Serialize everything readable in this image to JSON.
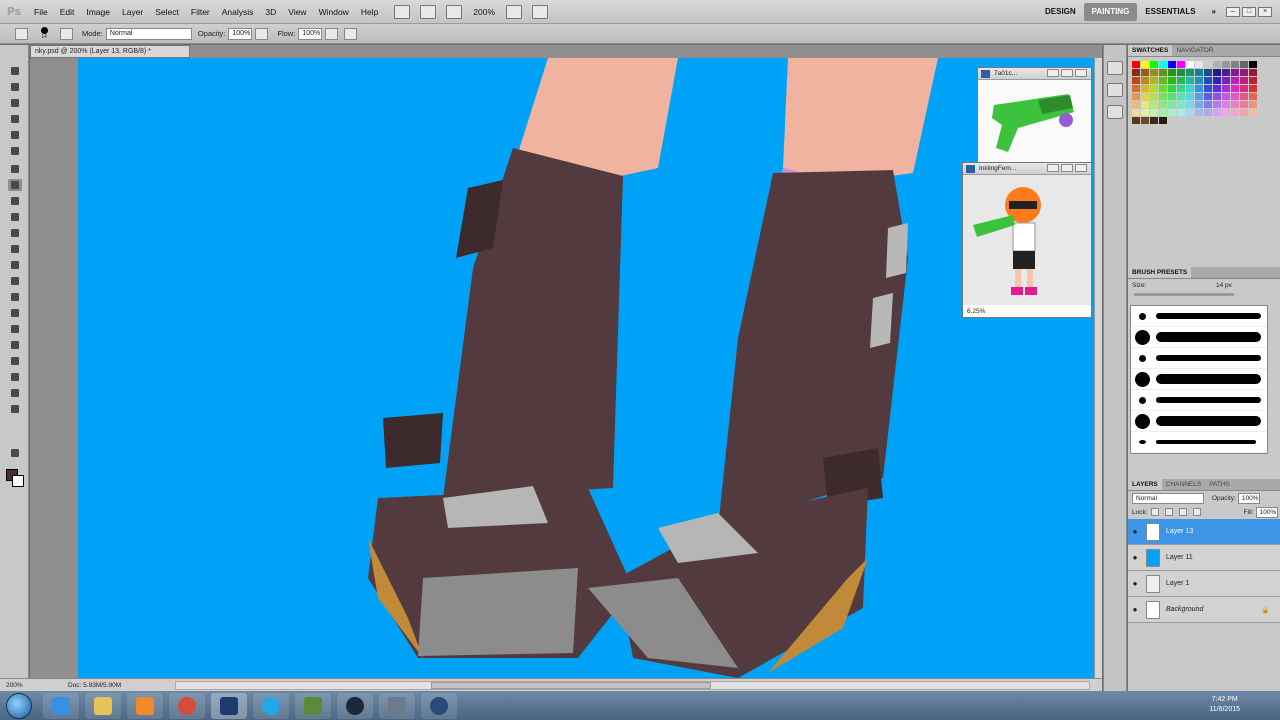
{
  "app": {
    "logo": "Ps"
  },
  "menu": [
    "File",
    "Edit",
    "Image",
    "Layer",
    "Select",
    "Filter",
    "Analysis",
    "3D",
    "View",
    "Window",
    "Help"
  ],
  "menubar": {
    "zoom": "200%"
  },
  "workspaces": {
    "design": "DESIGN",
    "painting": "PAINTING",
    "essentials": "ESSENTIALS",
    "more": "»"
  },
  "options": {
    "brush_size": "14",
    "mode_label": "Mode:",
    "mode_value": "Normal",
    "opacity_label": "Opacity:",
    "opacity_value": "100%",
    "flow_label": "Flow:",
    "flow_value": "100%"
  },
  "document": {
    "tab_title": "nky.psd @ 200% (Layer 13, RGB/8) *"
  },
  "ref_windows": [
    {
      "title": "7a01c...",
      "zoom": ""
    },
    {
      "title": "InklingFem...",
      "zoom": "6.25%"
    }
  ],
  "status": {
    "zoom": "200%",
    "doc_size": "Doc: 5.93M/5.90M"
  },
  "panels": {
    "swatches": {
      "tab": "SWATCHES",
      "tab2": "NAVIGATOR"
    },
    "brush_presets": {
      "tab": "BRUSH PRESETS",
      "size_label": "Size:",
      "size_value": "14 px"
    },
    "layers": {
      "tab": "LAYERS",
      "tab2": "CHANNELS",
      "tab3": "PATHS",
      "blend_mode": "Normal",
      "opacity_label": "Opacity:",
      "opacity_value": "100%",
      "lock_label": "Lock:",
      "fill_label": "Fill:",
      "fill_value": "100%",
      "items": [
        {
          "name": "Layer 13"
        },
        {
          "name": "Layer 11"
        },
        {
          "name": "Layer 1"
        },
        {
          "name": "Background"
        }
      ]
    }
  },
  "taskbar": {
    "time": "7:42 PM",
    "date": "11/6/2015"
  },
  "colors": {
    "canvas_bg": "#00a2f8",
    "selection": "#3d95e8",
    "boot": "#533a3e"
  }
}
